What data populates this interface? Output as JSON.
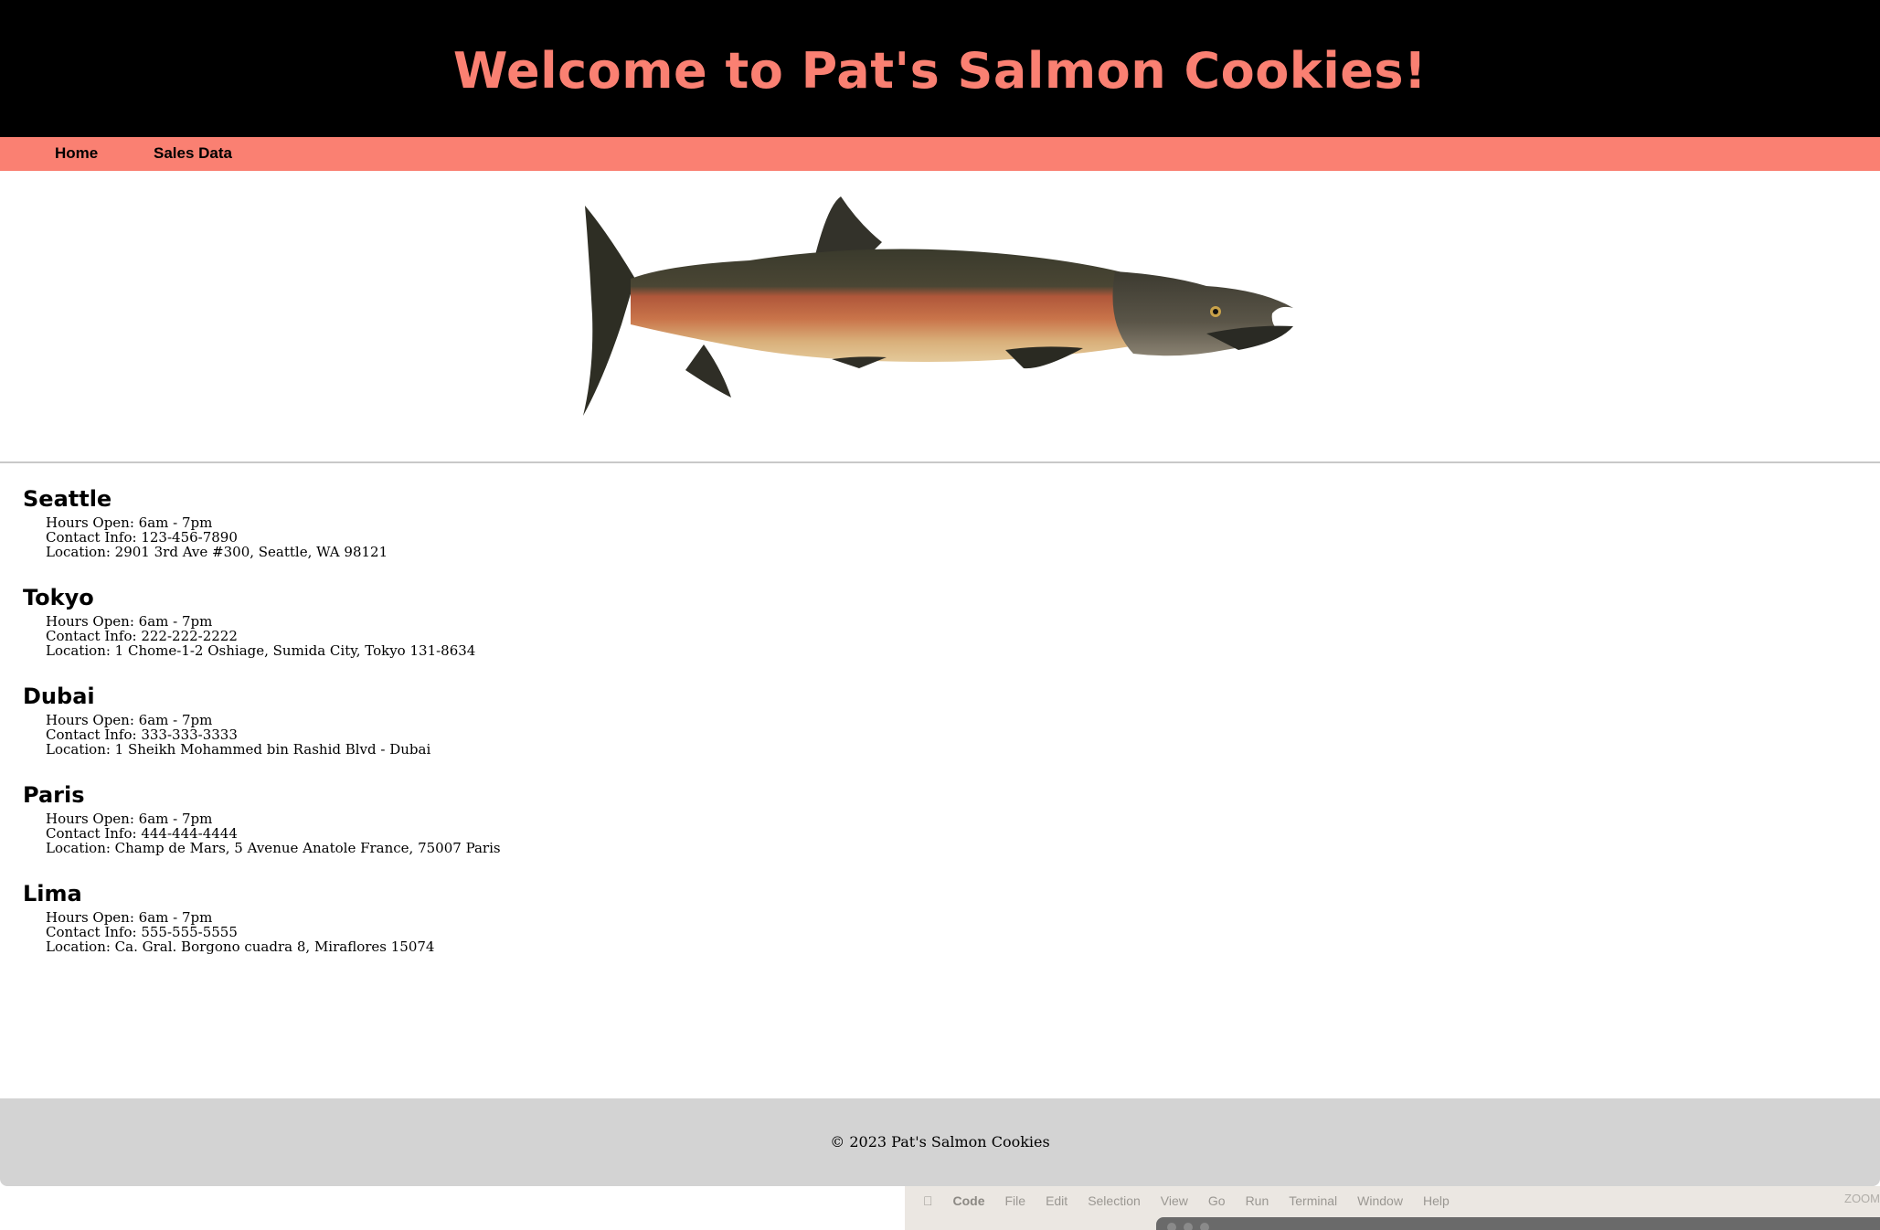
{
  "header": {
    "title": "Welcome to Pat's Salmon Cookies!"
  },
  "nav": {
    "items": [
      {
        "label": "Home"
      },
      {
        "label": "Sales Data"
      }
    ]
  },
  "hero": {
    "icon": "salmon-image"
  },
  "stores": [
    {
      "name": "Seattle",
      "hours": "Hours Open: 6am - 7pm",
      "contact": "Contact Info: 123-456-7890",
      "location": "Location: 2901 3rd Ave #300, Seattle, WA 98121"
    },
    {
      "name": "Tokyo",
      "hours": "Hours Open: 6am - 7pm",
      "contact": "Contact Info: 222-222-2222",
      "location": "Location: 1 Chome-1-2 Oshiage, Sumida City, Tokyo 131-8634"
    },
    {
      "name": "Dubai",
      "hours": "Hours Open: 6am - 7pm",
      "contact": "Contact Info: 333-333-3333",
      "location": "Location: 1 Sheikh Mohammed bin Rashid Blvd - Dubai"
    },
    {
      "name": "Paris",
      "hours": "Hours Open: 6am - 7pm",
      "contact": "Contact Info: 444-444-4444",
      "location": "Location: Champ de Mars, 5 Avenue Anatole France, 75007 Paris"
    },
    {
      "name": "Lima",
      "hours": "Hours Open: 6am - 7pm",
      "contact": "Contact Info: 555-555-5555",
      "location": "Location: Ca. Gral. Borgono cuadra 8, Miraflores 15074"
    }
  ],
  "footer": {
    "text": "© 2023 Pat's Salmon Cookies"
  },
  "os_menubar": {
    "items": [
      "Code",
      "File",
      "Edit",
      "Selection",
      "View",
      "Go",
      "Run",
      "Terminal",
      "Window",
      "Help"
    ],
    "right": "ZOOM"
  },
  "colors": {
    "header_bg": "#000000",
    "accent": "#fa8072",
    "footer_bg": "#d3d3d3"
  }
}
